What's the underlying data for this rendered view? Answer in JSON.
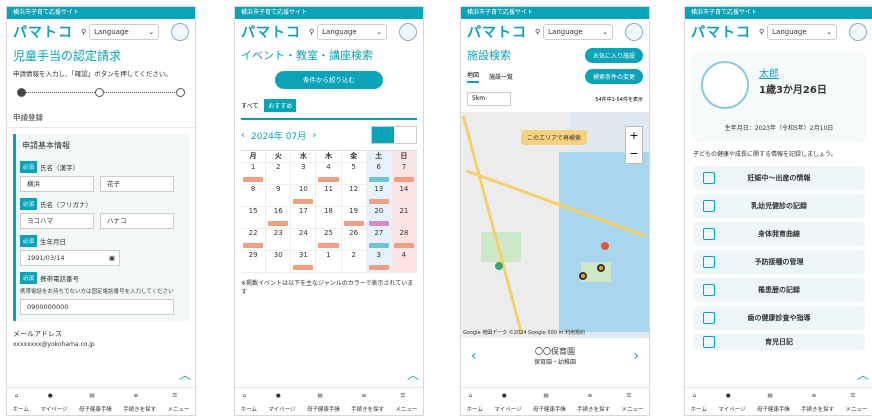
{
  "site_band": "横浜市子育て応援サイト",
  "logo": "パマトコ",
  "language_label": "Language",
  "bottom_nav": [
    "ホーム",
    "マイページ",
    "母子健康手帳",
    "手続きを探す",
    "メニュー"
  ],
  "screen1": {
    "title": "児童手当の認定請求",
    "desc": "申請情報を入力し、「確認」ボタンを押してください。",
    "section": "申請登録",
    "box_title": "申請基本情報",
    "required": "必須",
    "name_kanji_label": "氏名（漢字）",
    "name_kanji": [
      "横浜",
      "花子"
    ],
    "name_kana_label": "氏名（フリガナ）",
    "name_kana": [
      "ヨコハマ",
      "ハナコ"
    ],
    "dob_label": "生年月日",
    "dob_value": "1991/03/14",
    "phone_label": "携帯電話番号",
    "phone_note": "携帯電話をお持ちでない方は固定電話番号を入力してください",
    "phone_value": "0900000000",
    "mail_label": "メールアドレス",
    "mail_value": "xxxxxxxx@yokohama.co.jp"
  },
  "screen2": {
    "title": "イベント・教室・講座検索",
    "condition_button": "条件から絞り込む",
    "tab_all": "すべて",
    "tab_recommended": "おすすめ",
    "month": "2024年 07月",
    "weekdays": [
      "月",
      "火",
      "水",
      "木",
      "金",
      "土",
      "日"
    ],
    "weeks": [
      [
        "1",
        "2",
        "3",
        "4",
        "5",
        "6",
        "7"
      ],
      [
        "8",
        "9",
        "10",
        "11",
        "12",
        "13",
        "14"
      ],
      [
        "15",
        "16",
        "17",
        "18",
        "19",
        "20",
        "21"
      ],
      [
        "22",
        "23",
        "24",
        "25",
        "26",
        "27",
        "28"
      ],
      [
        "29",
        "30",
        "31",
        "1",
        "2",
        "3",
        "4"
      ]
    ],
    "note": "※掲載イベントは以下を主なジャンルのカラーで表示されています"
  },
  "screen3": {
    "title": "施設検索",
    "favorite_button": "お気に入り施設",
    "tab_map": "地図",
    "tab_list": "施設一覧",
    "change_button": "検索条件の変更",
    "distance": "5km",
    "count": "54件中1-54件を表示",
    "search_here": "このエリアで再検索",
    "map_copy": "Google 地図データ ©2024 Google 500 m 利用規約",
    "facility_name": "〇〇保育園",
    "facility_type": "保育園・幼稚園"
  },
  "screen4": {
    "child_name": "太郎",
    "child_age": "1歳3か月26日",
    "birthday": "生年月日：2023年（令和5年）2月10日",
    "hint": "子どもの健康や成長に関する情報を記録しましょう。",
    "menus": [
      "妊娠中〜出産の情報",
      "乳幼児健診の記録",
      "身体発育曲線",
      "予防接種の管理",
      "罹患歴の記録",
      "歯の健康診査や指導",
      "育児日記"
    ]
  }
}
